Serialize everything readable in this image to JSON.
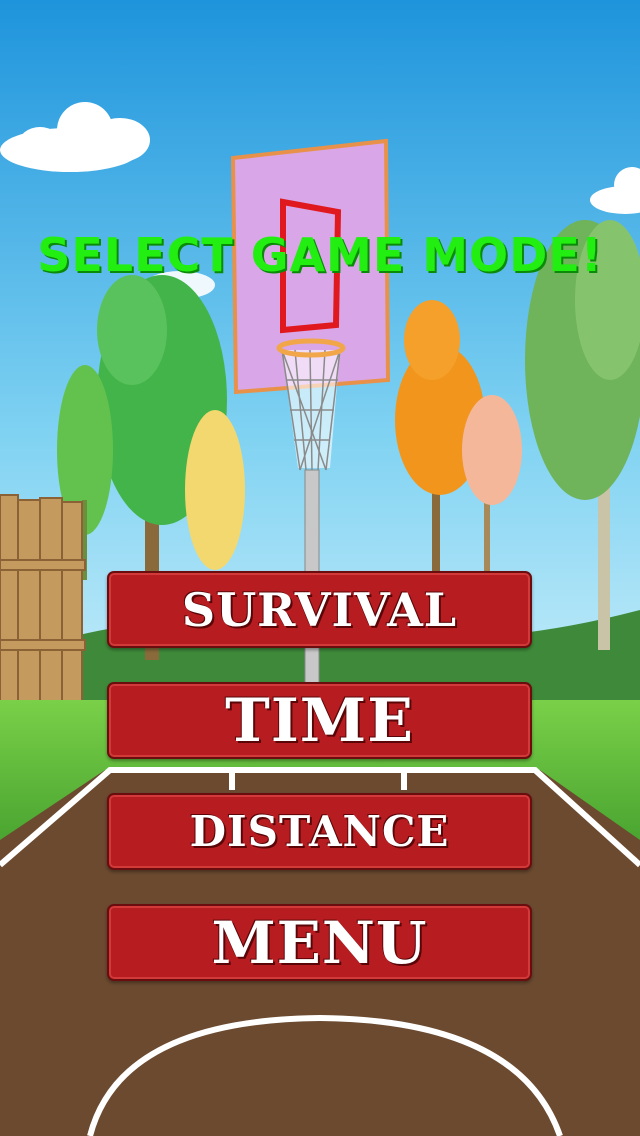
{
  "screen": {
    "title": "SELECT GAME MODE!"
  },
  "buttons": {
    "survival": "SURVIVAL",
    "time": "TIME",
    "distance": "DISTANCE",
    "menu": "MENU"
  },
  "colors": {
    "sky": "#2a9fe0",
    "grass": "#6cc63e",
    "court": "#6b4a30",
    "button": "#b61c20",
    "title": "#22ee11"
  }
}
